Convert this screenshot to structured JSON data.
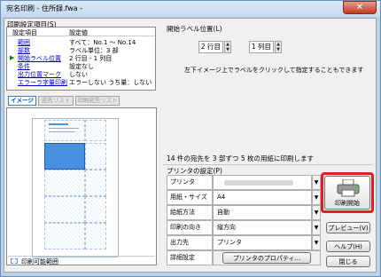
{
  "window": {
    "title": "宛名印刷 - 住所録.fwa -",
    "close_glyph": "✕"
  },
  "settings_group": {
    "label": "印刷設定項目(S)",
    "col_item": "設定項目",
    "col_value": "設定値",
    "rows": [
      {
        "item": "範囲",
        "value": "すべて：No.1 ～ No.14"
      },
      {
        "item": "部数",
        "value": "ラベル単位：3 部"
      },
      {
        "item": "開始ラベル位置",
        "value": "2 行目 - 1 列目"
      },
      {
        "item": "条件",
        "value": "設定なし"
      },
      {
        "item": "出力位置マーク",
        "value": "しない"
      },
      {
        "item": "エラーラ字量印刷",
        "value": "エラーしない うち量：しない"
      }
    ]
  },
  "view_tabs": {
    "image": "イメージ",
    "address_list": "宛先リスト",
    "print_list": "印刷宛先リスト"
  },
  "preview": {
    "printable_label": "印刷可能範囲"
  },
  "start_position": {
    "label": "開始ラベル位置(L)",
    "row_value": "2 行目",
    "col_value": "1 列目",
    "hint": "左下イメージ上でラベルをクリックして指定することもできます"
  },
  "summary": "14 件の宛先を 3 部ずつ 5 枚の用紙に印刷します",
  "printer_group": {
    "label": "プリンタの設定(P)",
    "rows": [
      {
        "label": "プリンタ",
        "value": ""
      },
      {
        "label": "用紙・サイズ",
        "value": "A4"
      },
      {
        "label": "給紙方法",
        "value": "自動"
      },
      {
        "label": "印刷の向き",
        "value": "縦方向"
      },
      {
        "label": "出力先",
        "value": "プリンタ"
      }
    ],
    "detail_label": "詳細設定",
    "properties_button": "プリンタのプロパティ..."
  },
  "buttons": {
    "print_start": "印刷開始",
    "preview": "プレビュー(V)",
    "help": "ヘルプ(H)",
    "close": "閉じる"
  },
  "colors": {
    "highlight": "#e02020",
    "selected_label": "#4a8fe0"
  }
}
